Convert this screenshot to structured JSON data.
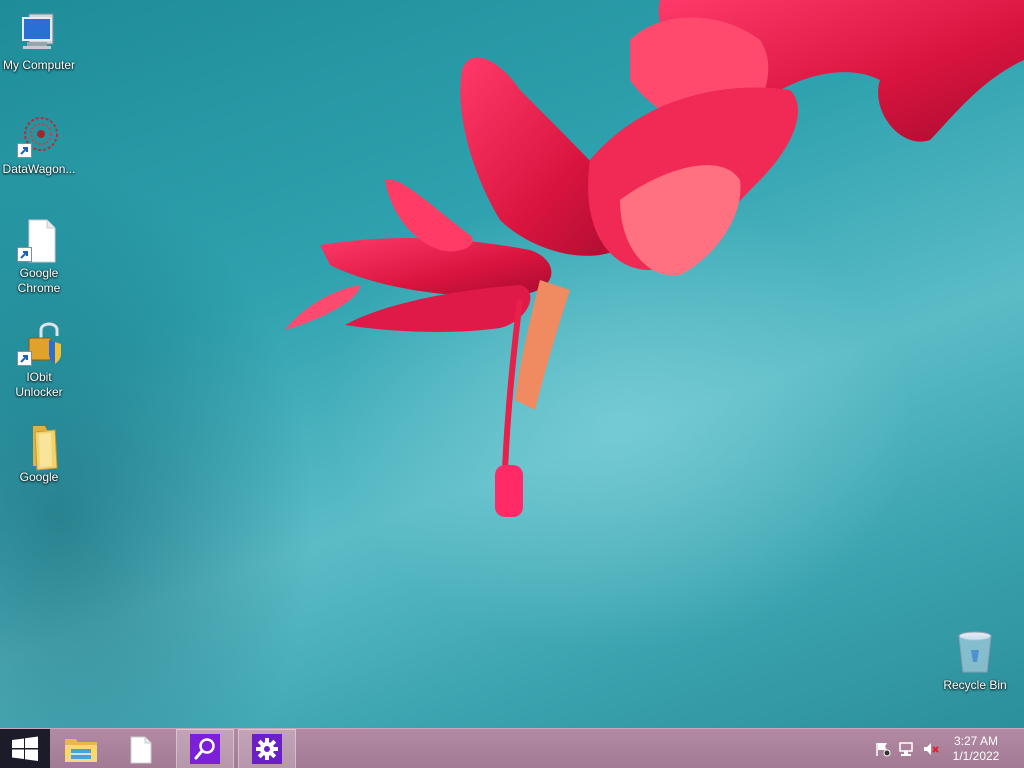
{
  "desktop": {
    "icons": [
      {
        "label": "My Computer",
        "icon": "computer-icon"
      },
      {
        "label": "DataWagon...",
        "icon": "datawagon-icon"
      },
      {
        "label": "Google Chrome",
        "icon": "document-icon"
      },
      {
        "label": "IObit Unlocker",
        "icon": "unlocker-icon"
      },
      {
        "label": "Google",
        "icon": "folder-icon"
      },
      {
        "label": "Recycle Bin",
        "icon": "recycle-bin-icon"
      }
    ]
  },
  "taskbar": {
    "start": {
      "icon": "windows-logo-icon"
    },
    "pinned": [
      {
        "name": "File Explorer",
        "icon": "file-explorer-icon"
      },
      {
        "name": "Document",
        "icon": "document-icon"
      },
      {
        "name": "Search",
        "icon": "search-icon"
      },
      {
        "name": "Settings",
        "icon": "gear-icon"
      }
    ],
    "tray": {
      "icons": [
        "action-center-flag-icon",
        "network-icon",
        "volume-muted-icon"
      ],
      "time": "3:27 AM",
      "date": "1/1/2022"
    }
  },
  "colors": {
    "taskbar": "#a8809a",
    "search_tile": "#7b1fd8",
    "settings_tile": "#6a1fc8",
    "wallpaper_teal": "#2ea2ae",
    "flower": "#e8204a"
  }
}
